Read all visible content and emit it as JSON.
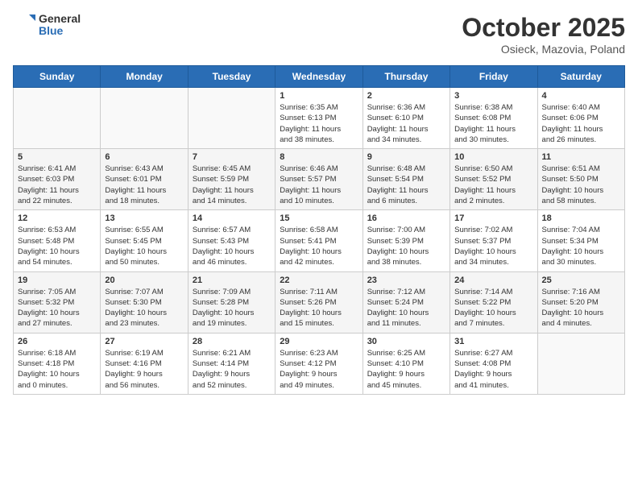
{
  "header": {
    "logo": {
      "line1": "General",
      "line2": "Blue"
    },
    "title": "October 2025",
    "subtitle": "Osieck, Mazovia, Poland"
  },
  "weekdays": [
    "Sunday",
    "Monday",
    "Tuesday",
    "Wednesday",
    "Thursday",
    "Friday",
    "Saturday"
  ],
  "weeks": [
    [
      {
        "day": "",
        "info": ""
      },
      {
        "day": "",
        "info": ""
      },
      {
        "day": "",
        "info": ""
      },
      {
        "day": "1",
        "info": "Sunrise: 6:35 AM\nSunset: 6:13 PM\nDaylight: 11 hours\nand 38 minutes."
      },
      {
        "day": "2",
        "info": "Sunrise: 6:36 AM\nSunset: 6:10 PM\nDaylight: 11 hours\nand 34 minutes."
      },
      {
        "day": "3",
        "info": "Sunrise: 6:38 AM\nSunset: 6:08 PM\nDaylight: 11 hours\nand 30 minutes."
      },
      {
        "day": "4",
        "info": "Sunrise: 6:40 AM\nSunset: 6:06 PM\nDaylight: 11 hours\nand 26 minutes."
      }
    ],
    [
      {
        "day": "5",
        "info": "Sunrise: 6:41 AM\nSunset: 6:03 PM\nDaylight: 11 hours\nand 22 minutes."
      },
      {
        "day": "6",
        "info": "Sunrise: 6:43 AM\nSunset: 6:01 PM\nDaylight: 11 hours\nand 18 minutes."
      },
      {
        "day": "7",
        "info": "Sunrise: 6:45 AM\nSunset: 5:59 PM\nDaylight: 11 hours\nand 14 minutes."
      },
      {
        "day": "8",
        "info": "Sunrise: 6:46 AM\nSunset: 5:57 PM\nDaylight: 11 hours\nand 10 minutes."
      },
      {
        "day": "9",
        "info": "Sunrise: 6:48 AM\nSunset: 5:54 PM\nDaylight: 11 hours\nand 6 minutes."
      },
      {
        "day": "10",
        "info": "Sunrise: 6:50 AM\nSunset: 5:52 PM\nDaylight: 11 hours\nand 2 minutes."
      },
      {
        "day": "11",
        "info": "Sunrise: 6:51 AM\nSunset: 5:50 PM\nDaylight: 10 hours\nand 58 minutes."
      }
    ],
    [
      {
        "day": "12",
        "info": "Sunrise: 6:53 AM\nSunset: 5:48 PM\nDaylight: 10 hours\nand 54 minutes."
      },
      {
        "day": "13",
        "info": "Sunrise: 6:55 AM\nSunset: 5:45 PM\nDaylight: 10 hours\nand 50 minutes."
      },
      {
        "day": "14",
        "info": "Sunrise: 6:57 AM\nSunset: 5:43 PM\nDaylight: 10 hours\nand 46 minutes."
      },
      {
        "day": "15",
        "info": "Sunrise: 6:58 AM\nSunset: 5:41 PM\nDaylight: 10 hours\nand 42 minutes."
      },
      {
        "day": "16",
        "info": "Sunrise: 7:00 AM\nSunset: 5:39 PM\nDaylight: 10 hours\nand 38 minutes."
      },
      {
        "day": "17",
        "info": "Sunrise: 7:02 AM\nSunset: 5:37 PM\nDaylight: 10 hours\nand 34 minutes."
      },
      {
        "day": "18",
        "info": "Sunrise: 7:04 AM\nSunset: 5:34 PM\nDaylight: 10 hours\nand 30 minutes."
      }
    ],
    [
      {
        "day": "19",
        "info": "Sunrise: 7:05 AM\nSunset: 5:32 PM\nDaylight: 10 hours\nand 27 minutes."
      },
      {
        "day": "20",
        "info": "Sunrise: 7:07 AM\nSunset: 5:30 PM\nDaylight: 10 hours\nand 23 minutes."
      },
      {
        "day": "21",
        "info": "Sunrise: 7:09 AM\nSunset: 5:28 PM\nDaylight: 10 hours\nand 19 minutes."
      },
      {
        "day": "22",
        "info": "Sunrise: 7:11 AM\nSunset: 5:26 PM\nDaylight: 10 hours\nand 15 minutes."
      },
      {
        "day": "23",
        "info": "Sunrise: 7:12 AM\nSunset: 5:24 PM\nDaylight: 10 hours\nand 11 minutes."
      },
      {
        "day": "24",
        "info": "Sunrise: 7:14 AM\nSunset: 5:22 PM\nDaylight: 10 hours\nand 7 minutes."
      },
      {
        "day": "25",
        "info": "Sunrise: 7:16 AM\nSunset: 5:20 PM\nDaylight: 10 hours\nand 4 minutes."
      }
    ],
    [
      {
        "day": "26",
        "info": "Sunrise: 6:18 AM\nSunset: 4:18 PM\nDaylight: 10 hours\nand 0 minutes."
      },
      {
        "day": "27",
        "info": "Sunrise: 6:19 AM\nSunset: 4:16 PM\nDaylight: 9 hours\nand 56 minutes."
      },
      {
        "day": "28",
        "info": "Sunrise: 6:21 AM\nSunset: 4:14 PM\nDaylight: 9 hours\nand 52 minutes."
      },
      {
        "day": "29",
        "info": "Sunrise: 6:23 AM\nSunset: 4:12 PM\nDaylight: 9 hours\nand 49 minutes."
      },
      {
        "day": "30",
        "info": "Sunrise: 6:25 AM\nSunset: 4:10 PM\nDaylight: 9 hours\nand 45 minutes."
      },
      {
        "day": "31",
        "info": "Sunrise: 6:27 AM\nSunset: 4:08 PM\nDaylight: 9 hours\nand 41 minutes."
      },
      {
        "day": "",
        "info": ""
      }
    ]
  ]
}
